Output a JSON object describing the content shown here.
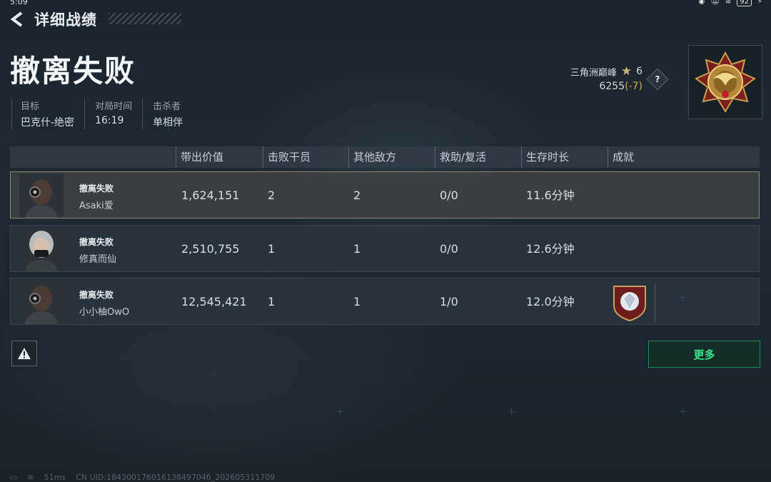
{
  "status": {
    "time": "5:09",
    "battery": "92"
  },
  "header": {
    "title": "详细战绩"
  },
  "result": "撤离失败",
  "meta": [
    {
      "label": "目标",
      "value": "巴克什-绝密"
    },
    {
      "label": "对局时间",
      "value": "16:19"
    },
    {
      "label": "击杀者",
      "value": "单相伴"
    }
  ],
  "rank": {
    "name": "三角洲巅峰",
    "stars": "6",
    "score": "6255",
    "delta": "(-7)",
    "help": "?"
  },
  "table": {
    "headers": [
      "带出价值",
      "击败干员",
      "其他敌方",
      "救助/复活",
      "生存时长",
      "成就"
    ],
    "rows": [
      {
        "status": "撤离失败",
        "name": "Asaki爱",
        "value": "1,624,151",
        "kills": "2",
        "others": "2",
        "assist": "0/0",
        "time": "11.6分钟",
        "achievement": ""
      },
      {
        "status": "撤离失败",
        "name": "修真而仙",
        "value": "2,510,755",
        "kills": "1",
        "others": "1",
        "assist": "0/0",
        "time": "12.6分钟",
        "achievement": ""
      },
      {
        "status": "撤离失败",
        "name": "小小柚OwO",
        "value": "12,545,421",
        "kills": "1",
        "others": "1",
        "assist": "1/0",
        "time": "12.0分钟",
        "achievement": "diamond-badge"
      }
    ]
  },
  "buttons": {
    "more": "更多"
  },
  "footer": {
    "ping": "51ms",
    "uid": "CN UID:18430017601613849704б_202605311709"
  }
}
